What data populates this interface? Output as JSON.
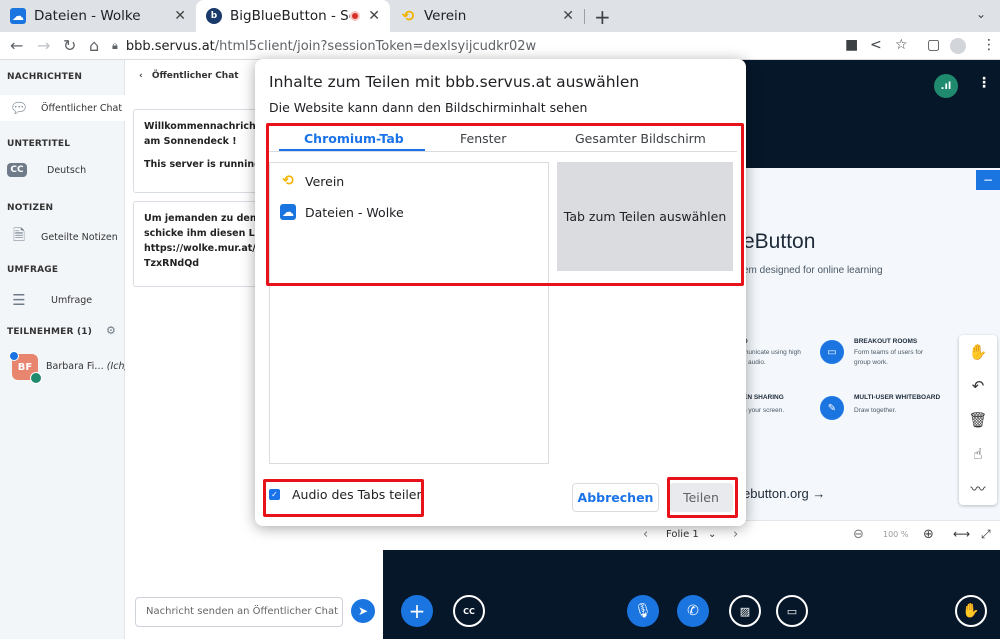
{
  "browser": {
    "tabs": [
      {
        "title": "Dateien - Wolke",
        "icon": "cloud-favicon",
        "color": "#1b75e0"
      },
      {
        "title": "BigBlueButton - Sonn",
        "icon": "bbb-favicon",
        "color": "#1a3a6b",
        "recording": true
      },
      {
        "title": "Verein",
        "icon": "verein-favicon",
        "color": "#f2b400"
      }
    ],
    "url_host": "bbb.servus.at",
    "url_path": "/html5client/join?sessionToken=dexlsyijcudkr02w"
  },
  "sidebar": {
    "messages_heading": "NACHRICHTEN",
    "public_chat_label": "Öffentlicher Chat",
    "captions_heading": "UNTERTITEL",
    "captions_item": "Deutsch",
    "notes_heading": "NOTIZEN",
    "notes_item": "Geteilte Notizen",
    "poll_heading": "UMFRAGE",
    "poll_item": "Umfrage",
    "participants_heading": "TEILNEHMER (1)",
    "user_initials": "BF",
    "user_name": "Barbara Fi…",
    "user_suffix": "(Ich)"
  },
  "chat": {
    "back_title": "Öffentlicher Chat",
    "msg1_line1": "Willkommennachricht f",
    "msg1_line2": "am Sonnendeck !",
    "msg1_line3": "This server is running B",
    "msg2_line1": "Um jemanden zu dem T",
    "msg2_line2": "schicke ihm diesen Link",
    "msg2_line3": "https://wolke.mur.at/ap",
    "msg2_line4": "TzxRNdQd",
    "input_placeholder": "Nachricht senden an Öffentlicher Chat"
  },
  "presentation": {
    "title_fragment": "eButton",
    "subtitle_fragment": "em designed for online learning",
    "feature1_head": "D",
    "feature1_text1": "municate using high",
    "feature1_text2": "y audio.",
    "feature2_head": "BREAKOUT ROOMS",
    "feature2_text1": "Form teams of users for",
    "feature2_text2": "group work.",
    "feature3_head": "EN SHARING",
    "feature3_text": "n your screen.",
    "feature4_head": "MULTI-USER WHITEBOARD",
    "feature4_text": "Draw together.",
    "link_fragment": "ebutton.org →",
    "slide_selector": "Folie 1",
    "zoom_level": "100 %"
  },
  "dialog": {
    "title": "Inhalte zum Teilen mit bbb.servus.at auswählen",
    "subtitle": "Die Website kann dann den Bildschirminhalt sehen",
    "tabs": [
      "Chromium-Tab",
      "Fenster",
      "Gesamter Bildschirm"
    ],
    "list_items": [
      {
        "label": "Verein",
        "icon": "verein-favicon"
      },
      {
        "label": "Dateien - Wolke",
        "icon": "cloud-favicon"
      }
    ],
    "preview_text": "Tab zum Teilen auswählen",
    "audio_label": "Audio des Tabs teilen",
    "audio_checked": true,
    "cancel_label": "Abbrechen",
    "share_label": "Teilen"
  },
  "colors": {
    "accent": "#1a73e8",
    "bbb_blue": "#1b75e0",
    "highlight_red": "#e8131a",
    "stage_dark": "#06172a"
  }
}
